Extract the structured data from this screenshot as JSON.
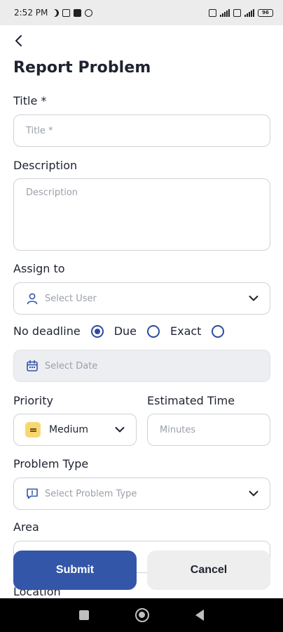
{
  "status_bar": {
    "time": "2:52 PM",
    "battery": "96"
  },
  "header": {
    "title": "Report Problem"
  },
  "form": {
    "title_label": "Title *",
    "title_placeholder": "Title *",
    "description_label": "Description",
    "description_placeholder": "Description",
    "assign_label": "Assign to",
    "assign_placeholder": "Select User",
    "deadline_options": [
      "No deadline",
      "Due",
      "Exact"
    ],
    "deadline_selected": "No deadline",
    "date_placeholder": "Select Date",
    "priority_label": "Priority",
    "priority_value": "Medium",
    "estimated_label": "Estimated Time",
    "estimated_placeholder": "Minutes",
    "problem_type_label": "Problem Type",
    "problem_type_placeholder": "Select Problem Type",
    "area_label": "Area",
    "location_label": "Location"
  },
  "actions": {
    "submit_label": "Submit",
    "cancel_label": "Cancel"
  },
  "colors": {
    "primary": "#3356a8",
    "priority_medium": "#f7d774",
    "radio": "#2e4aa0"
  },
  "icons": {
    "back": "arrow-left-icon",
    "user": "user-icon",
    "calendar": "calendar-icon",
    "problem_type": "alert-message-icon",
    "chevron": "chevron-down-icon"
  }
}
